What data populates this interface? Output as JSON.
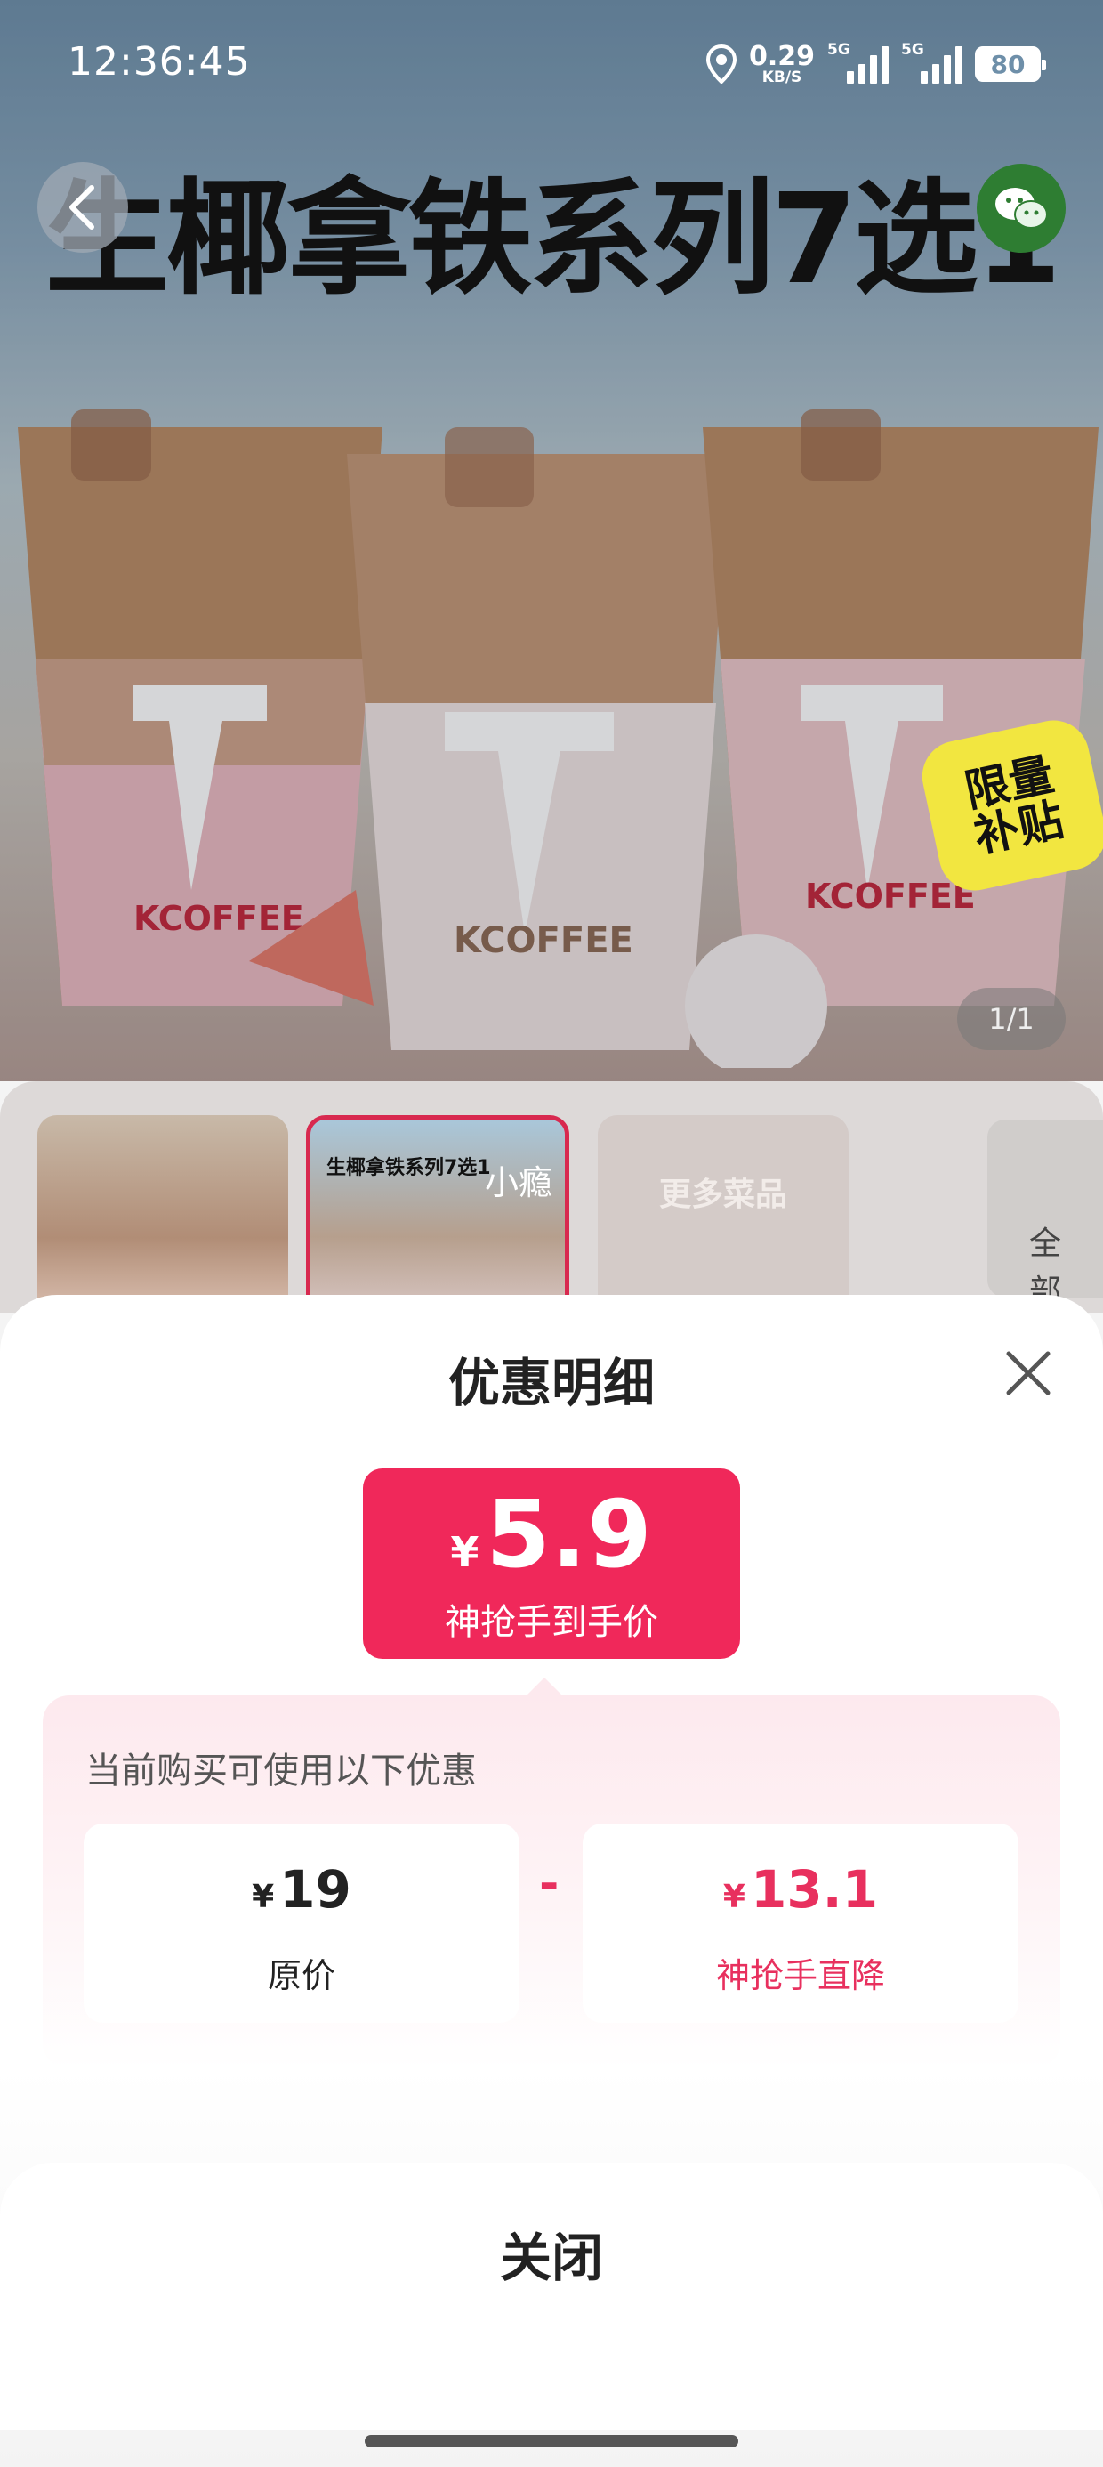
{
  "status_bar": {
    "time": "12:36:45",
    "net_speed_value": "0.29",
    "net_speed_unit": "KB/S",
    "signal1_label": "5G",
    "signal2_label": "5G",
    "battery_level": "80",
    "location_icon": "location-pin-icon"
  },
  "hero": {
    "title": "生椰拿铁系列7选1",
    "brand_1": "KCOFFEE",
    "brand_2": "KCOFFEE",
    "brand_3": "KCOFFEE",
    "badge_line1": "限量",
    "badge_line2": "补贴",
    "page_indicator": "1/1",
    "back_icon": "chevron-left-icon",
    "share_icon": "wechat-icon"
  },
  "thumbnails": {
    "items": [
      {
        "label": ""
      },
      {
        "title": "生椰拿铁系列7选1",
        "tag": "小瘾"
      },
      {
        "label": "更多菜品"
      }
    ],
    "all_label_1": "全",
    "all_label_2": "部"
  },
  "sheet": {
    "title": "优惠明细",
    "close_icon": "close-icon",
    "final_price": {
      "currency": "¥",
      "value": "5.9",
      "label": "神抢手到手价"
    },
    "detail": {
      "caption": "当前购买可使用以下优惠",
      "original": {
        "currency": "¥",
        "value": "19",
        "label": "原价"
      },
      "operator": "-",
      "discount": {
        "currency": "¥",
        "value": "13.1",
        "label": "神抢手直降"
      }
    },
    "close_button_label": "关闭"
  },
  "colors": {
    "accent": "#f0285a",
    "accent_text": "#e8305e",
    "panel_bg": "#fde9ee"
  }
}
